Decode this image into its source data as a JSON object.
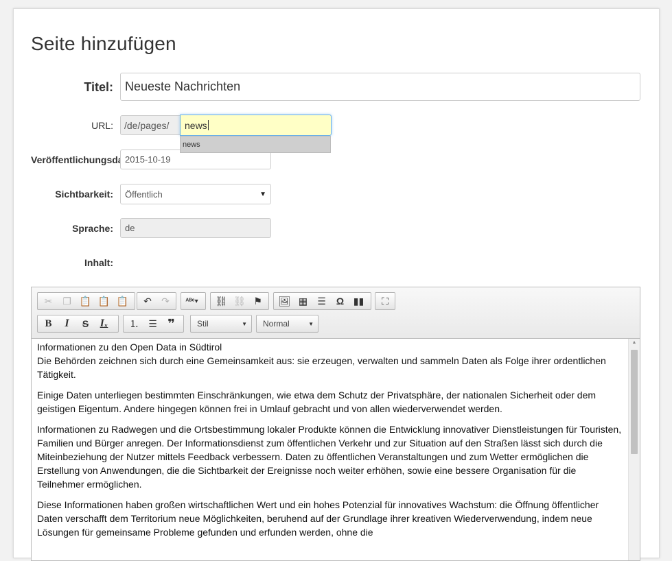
{
  "page": {
    "title": "Seite hinzufügen"
  },
  "form": {
    "title": {
      "label": "Titel:",
      "value": "Neueste Nachrichten"
    },
    "url": {
      "label": "URL:",
      "prefix": "/de/pages/",
      "value": "news",
      "suggestion": "news"
    },
    "publish_date": {
      "label": "Veröffentlichungsdatum:",
      "value": "2015-10-19"
    },
    "visibility": {
      "label": "Sichtbarkeit:",
      "value": "Öffentlich"
    },
    "language": {
      "label": "Sprache:",
      "value": "de"
    },
    "content": {
      "label": "Inhalt:"
    }
  },
  "editor": {
    "toolbar": {
      "row1": [
        [
          "scissors-icon",
          "copy-icon",
          "paste-icon",
          "paste-text-icon",
          "paste-word-icon"
        ],
        [
          "undo-icon",
          "redo-icon"
        ],
        [
          "spellcheck-icon"
        ],
        [
          "link-icon",
          "unlink-icon",
          "anchor-icon"
        ],
        [
          "image-icon",
          "table-icon",
          "horizontal-rule-icon",
          "special-char-icon",
          "chart-icon"
        ],
        [
          "maximize-icon"
        ]
      ],
      "style_combo": "Stil",
      "format_combo": "Normal"
    },
    "paragraphs": [
      "Informationen zu den Open Data in Südtirol",
      "Die Behörden zeichnen sich durch eine Gemeinsamkeit aus: sie erzeugen, verwalten und sammeln Daten als Folge ihrer ordentlichen Tätigkeit.",
      "Einige Daten unterliegen bestimmten Einschränkungen, wie etwa dem Schutz der Privatsphäre, der nationalen Sicherheit oder dem geistigen Eigentum. Andere hingegen können frei in Umlauf gebracht und von allen wiederverwendet werden.",
      "Informationen zu Radwegen und die Ortsbestimmung lokaler Produkte können die Entwicklung innovativer Dienstleistungen für Touristen, Familien und Bürger anregen. Der Informationsdienst zum öffentlichen Verkehr und zur Situation auf den Straßen lässt sich durch die Miteinbeziehung der Nutzer mittels Feedback verbessern. Daten zu öffentlichen Veranstaltungen und zum Wetter ermöglichen die Erstellung von Anwendungen, die die Sichtbarkeit der Ereignisse noch weiter erhöhen, sowie eine bessere Organisation für die Teilnehmer ermöglichen.",
      "Diese Informationen haben großen wirtschaftlichen Wert und ein hohes Potenzial für innovatives Wachstum: die Öffnung öffentlicher Daten verschafft dem Territorium neue Möglichkeiten, beruhend auf der Grundlage ihrer kreativen Wiederverwendung, indem neue Lösungen für gemeinsame Probleme gefunden und erfunden werden, ohne die"
    ]
  }
}
